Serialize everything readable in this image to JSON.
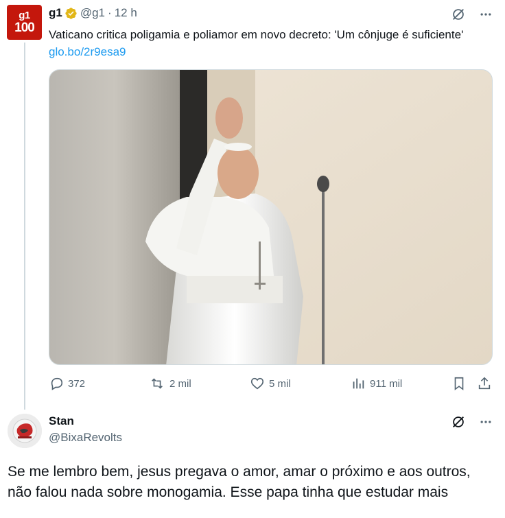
{
  "tweet": {
    "author_name": "g1",
    "handle": "@g1",
    "separator": "·",
    "time": "12 h",
    "avatar_top": "g1",
    "avatar_bottom": "100",
    "text": "Vaticano critica poligamia e poliamor em novo decreto: 'Um cônjuge é suficiente'",
    "link": "glo.bo/2r9esa9",
    "verified_color": "#e2b719"
  },
  "actions": {
    "replies": "372",
    "retweets": "2 mil",
    "likes": "5 mil",
    "views": "911 mil"
  },
  "reply": {
    "author_name": "Stan",
    "handle": "@BixaRevolts",
    "text": "Se me lembro bem, jesus pregava o amor, amar o próximo e aos outros, não falou nada sobre monogamia. Esse papa tinha que estudar mais"
  },
  "icons": [
    "grok-icon",
    "more-icon",
    "reply-icon",
    "retweet-icon",
    "like-icon",
    "views-icon",
    "bookmark-icon",
    "share-icon"
  ]
}
